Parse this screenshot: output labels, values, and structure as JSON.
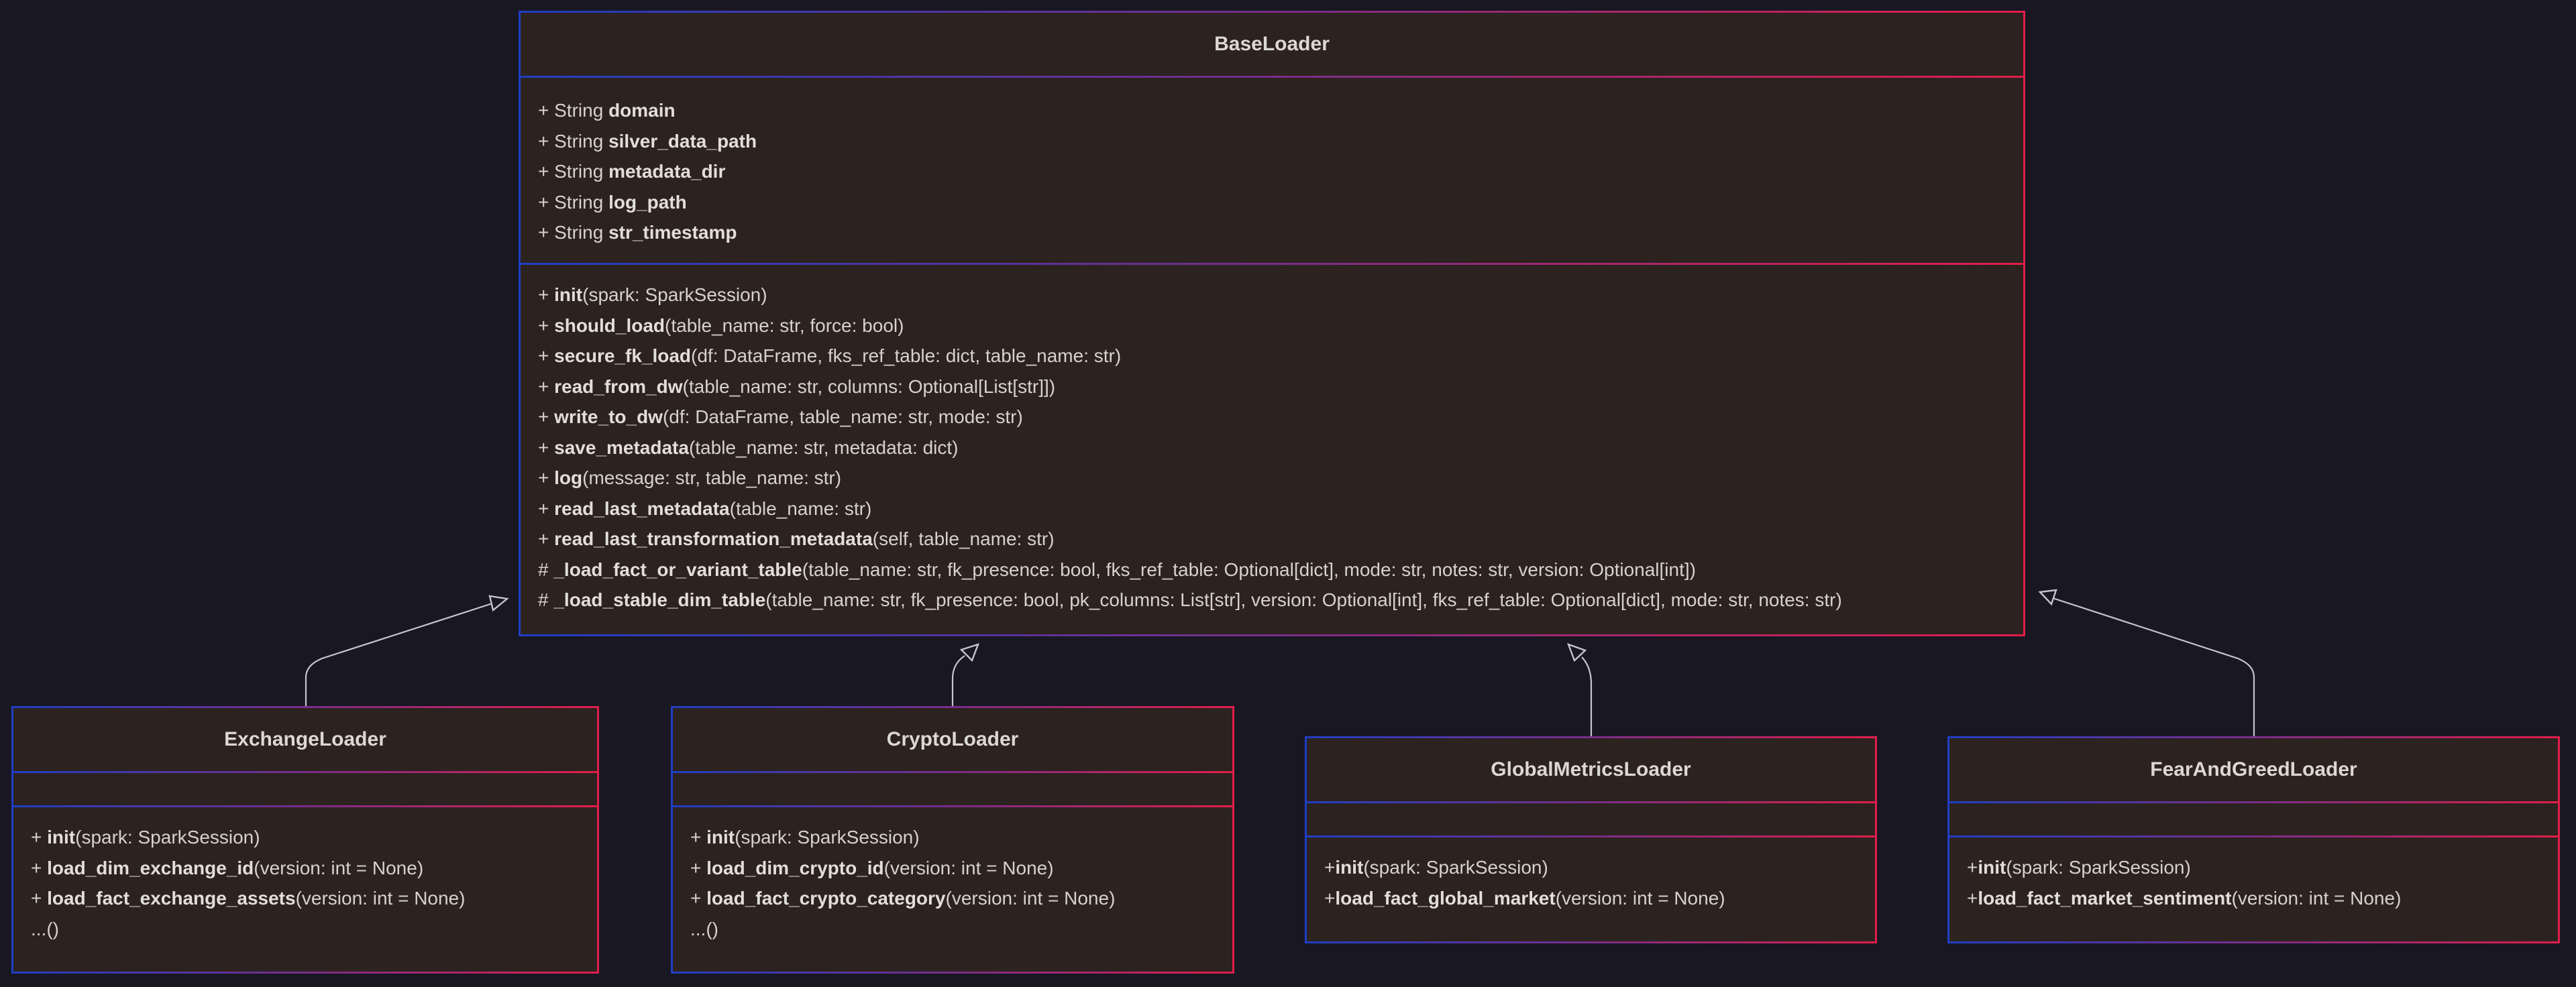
{
  "diagram": {
    "classes": [
      {
        "id": "BaseLoader",
        "name": "BaseLoader",
        "attributes": [
          {
            "prefix": "+ String ",
            "name": "domain",
            "suffix": ""
          },
          {
            "prefix": "+ String ",
            "name": "silver_data_path",
            "suffix": ""
          },
          {
            "prefix": "+ String ",
            "name": "metadata_dir",
            "suffix": ""
          },
          {
            "prefix": "+ String ",
            "name": "log_path",
            "suffix": ""
          },
          {
            "prefix": "+ String ",
            "name": "str_timestamp",
            "suffix": ""
          }
        ],
        "methods": [
          {
            "prefix": "+ ",
            "name": "init",
            "suffix": "(spark: SparkSession)"
          },
          {
            "prefix": "+ ",
            "name": "should_load",
            "suffix": "(table_name: str, force: bool)"
          },
          {
            "prefix": "+ ",
            "name": "secure_fk_load",
            "suffix": "(df: DataFrame, fks_ref_table: dict, table_name: str)"
          },
          {
            "prefix": "+ ",
            "name": "read_from_dw",
            "suffix": "(table_name: str, columns: Optional[List[str]])"
          },
          {
            "prefix": "+ ",
            "name": "write_to_dw",
            "suffix": "(df: DataFrame, table_name: str, mode: str)"
          },
          {
            "prefix": "+ ",
            "name": "save_metadata",
            "suffix": "(table_name: str, metadata: dict)"
          },
          {
            "prefix": "+ ",
            "name": "log",
            "suffix": "(message: str, table_name: str)"
          },
          {
            "prefix": "+ ",
            "name": "read_last_metadata",
            "suffix": "(table_name: str)"
          },
          {
            "prefix": "+ ",
            "name": "read_last_transformation_metadata",
            "suffix": "(self, table_name: str)"
          },
          {
            "prefix": "# ",
            "name": "_load_fact_or_variant_table",
            "suffix": "(table_name: str, fk_presence: bool, fks_ref_table: Optional[dict], mode: str, notes: str, version: Optional[int])"
          },
          {
            "prefix": "# ",
            "name": "_load_stable_dim_table",
            "suffix": "(table_name: str, fk_presence: bool, pk_columns: List[str], version: Optional[int], fks_ref_table: Optional[dict], mode: str, notes: str)"
          }
        ]
      },
      {
        "id": "ExchangeLoader",
        "name": "ExchangeLoader",
        "attributes": [],
        "methods": [
          {
            "prefix": "+ ",
            "name": "init",
            "suffix": "(spark: SparkSession)"
          },
          {
            "prefix": "+ ",
            "name": "load_dim_exchange_id",
            "suffix": "(version: int = None)"
          },
          {
            "prefix": "+ ",
            "name": "load_fact_exchange_assets",
            "suffix": "(version: int = None)"
          },
          {
            "prefix": "",
            "name": "",
            "suffix": "...()"
          }
        ]
      },
      {
        "id": "CryptoLoader",
        "name": "CryptoLoader",
        "attributes": [],
        "methods": [
          {
            "prefix": "+ ",
            "name": "init",
            "suffix": "(spark: SparkSession)"
          },
          {
            "prefix": "+ ",
            "name": "load_dim_crypto_id",
            "suffix": "(version: int = None)"
          },
          {
            "prefix": "+ ",
            "name": "load_fact_crypto_category",
            "suffix": "(version: int = None)"
          },
          {
            "prefix": "",
            "name": "",
            "suffix": "...()"
          }
        ]
      },
      {
        "id": "GlobalMetricsLoader",
        "name": "GlobalMetricsLoader",
        "attributes": [],
        "methods": [
          {
            "prefix": "+",
            "name": "init",
            "suffix": "(spark: SparkSession)"
          },
          {
            "prefix": "+",
            "name": "load_fact_global_market",
            "suffix": "(version: int = None)"
          }
        ]
      },
      {
        "id": "FearAndGreedLoader",
        "name": "FearAndGreedLoader",
        "attributes": [],
        "methods": [
          {
            "prefix": "+",
            "name": "init",
            "suffix": "(spark: SparkSession)"
          },
          {
            "prefix": "+",
            "name": "load_fact_market_sentiment",
            "suffix": "(version: int = None)"
          }
        ]
      }
    ],
    "relations": [
      {
        "type": "inheritance",
        "from": "ExchangeLoader",
        "to": "BaseLoader"
      },
      {
        "type": "inheritance",
        "from": "CryptoLoader",
        "to": "BaseLoader"
      },
      {
        "type": "inheritance",
        "from": "GlobalMetricsLoader",
        "to": "BaseLoader"
      },
      {
        "type": "inheritance",
        "from": "FearAndGreedLoader",
        "to": "BaseLoader"
      }
    ],
    "colors": {
      "background": "#181722",
      "box_fill": "#2c2220",
      "border_start": "#1f3fc4",
      "border_end": "#e11e4a",
      "edge": "#c8c4d2",
      "text": "#d8d4ce"
    }
  }
}
